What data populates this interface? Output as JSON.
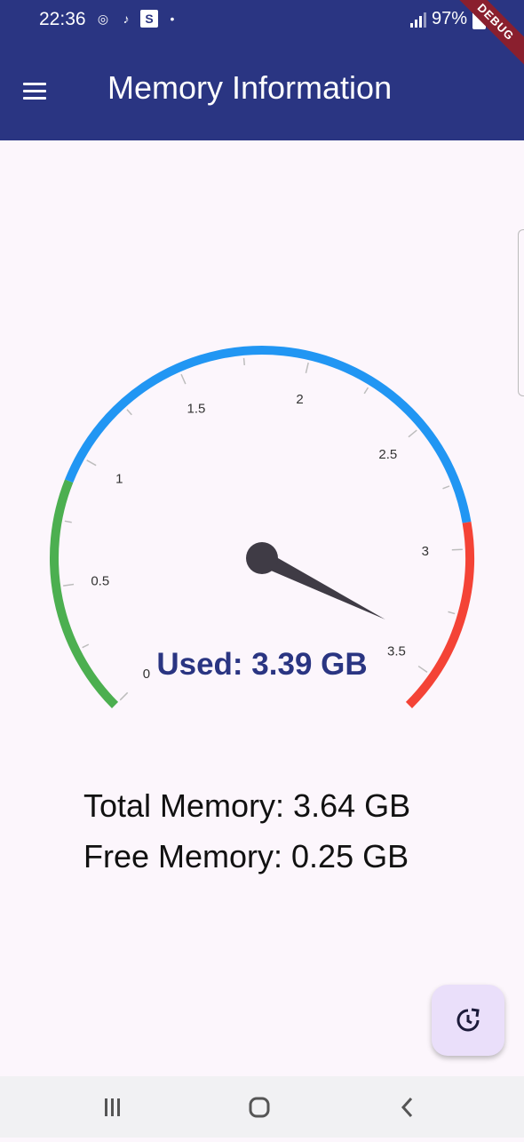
{
  "status_bar": {
    "time": "22:36",
    "battery": "97%",
    "notification_icons": [
      "app-icon",
      "tiktok-icon",
      "s-icon",
      "dot-icon"
    ]
  },
  "debug_banner": "DEBUG",
  "app_bar": {
    "title": "Memory Information",
    "menu_icon": "hamburger-menu-icon",
    "background_color": "#2a3582"
  },
  "chart_data": {
    "type": "gauge",
    "min": 0,
    "max": 3.64,
    "value": 3.39,
    "tick_labels": [
      "0",
      "0.5",
      "1",
      "1.5",
      "2",
      "2.5",
      "3",
      "3.5"
    ],
    "ranges": [
      {
        "from": 0,
        "to": 0.9,
        "color": "#4caf50"
      },
      {
        "from": 0.9,
        "to": 2.9,
        "color": "#2196f3"
      },
      {
        "from": 2.9,
        "to": 3.64,
        "color": "#f44336"
      }
    ],
    "annotation": "Used: 3.39 GB"
  },
  "memory": {
    "total_label": "Total Memory: 3.64 GB",
    "free_label": "Free Memory: 0.25 GB"
  },
  "fab": {
    "icon": "refresh-clock-icon"
  },
  "nav_bar": {
    "buttons": [
      "recent-apps-icon",
      "home-icon",
      "back-icon"
    ]
  }
}
